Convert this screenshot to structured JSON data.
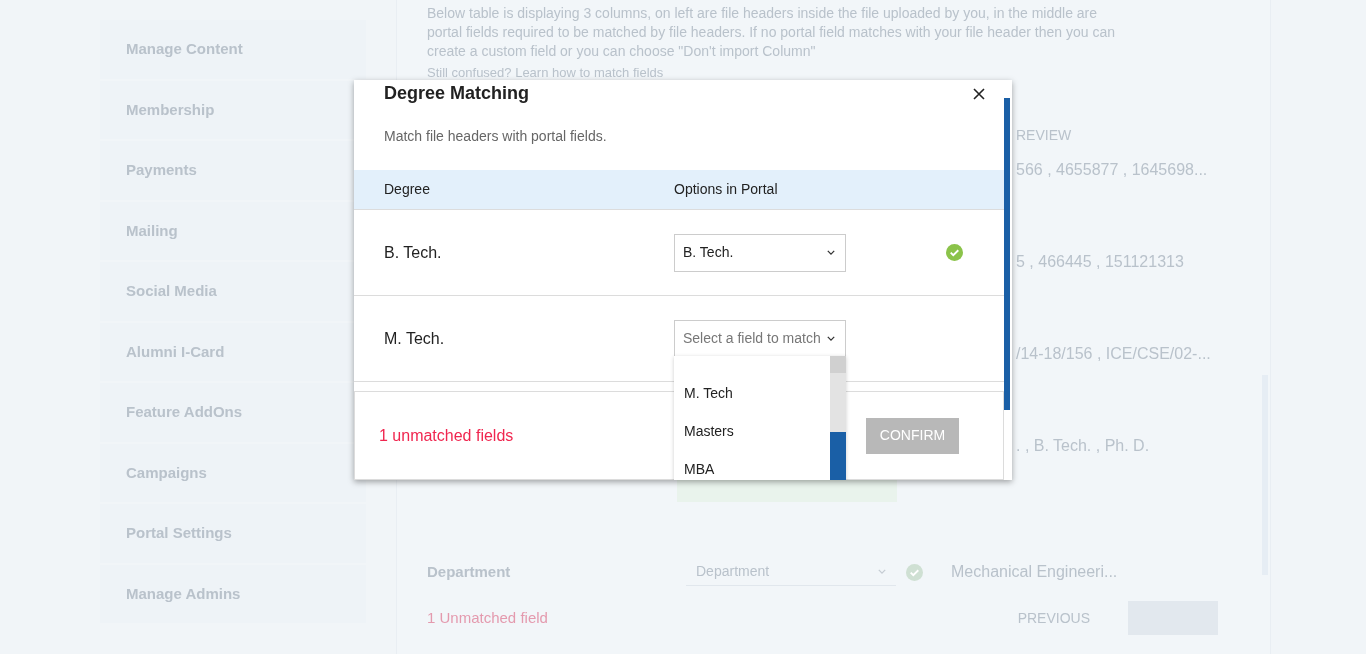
{
  "sidebar": {
    "items": [
      {
        "label": "Manage Content"
      },
      {
        "label": "Membership"
      },
      {
        "label": "Payments"
      },
      {
        "label": "Mailing"
      },
      {
        "label": "Social Media"
      },
      {
        "label": "Alumni I-Card"
      },
      {
        "label": "Feature AddOns"
      },
      {
        "label": "Campaigns"
      },
      {
        "label": "Portal Settings"
      },
      {
        "label": "Manage Admins"
      }
    ]
  },
  "page": {
    "intro": "Below table is displaying 3 columns, on left are file headers inside the file uploaded by you, in the middle are portal fields required to be matched by file headers. If no portal field matches with your file header then you can create a custom field or you can choose \"Don't import Column\"",
    "help_link": "Still confused? Learn how to match fields",
    "preview_header": "REVIEW",
    "preview_values": [
      "566 , 4655877 , 1645698...",
      "5 , 466445 , 151121313",
      "/14-18/156 , ICE/CSE/02-...",
      ". , B. Tech. , Ph. D."
    ],
    "department_row": {
      "header": "Department",
      "selected": "Department",
      "matched": true,
      "preview": "Mechanical Engineeri..."
    },
    "footer": {
      "unmatched": "1 Unmatched field",
      "previous": "PREVIOUS"
    }
  },
  "modal": {
    "title": "Degree Matching",
    "subtitle": "Match file headers with portal fields.",
    "columns": [
      "Degree",
      "Options in Portal"
    ],
    "rows": [
      {
        "degree": "B. Tech.",
        "value": "B. Tech.",
        "matched": true,
        "open": false
      },
      {
        "degree": "M. Tech.",
        "placeholder": "Select a field to match",
        "matched": false,
        "open": true
      }
    ],
    "options": [
      "M. Tech",
      "Masters",
      "MBA"
    ],
    "unmatched": "1 unmatched fields",
    "confirm": {
      "label": "CONFIRM",
      "disabled": true
    }
  }
}
